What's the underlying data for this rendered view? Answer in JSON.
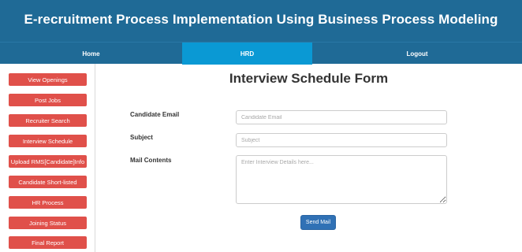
{
  "header": {
    "title": "E-recruitment Process Implementation Using Business Process Modeling"
  },
  "nav": {
    "items": [
      {
        "label": "Home",
        "active": false
      },
      {
        "label": "HRD",
        "active": true
      },
      {
        "label": "Logout",
        "active": false
      }
    ]
  },
  "sidebar": {
    "items": [
      {
        "label": "View Openings"
      },
      {
        "label": "Post Jobs"
      },
      {
        "label": "Recruiter Search"
      },
      {
        "label": "Interview Schedule"
      },
      {
        "label": "Upload RMS[Candidate]Info"
      },
      {
        "label": "Candidate Short-listed"
      },
      {
        "label": "HR Process"
      },
      {
        "label": "Joining Status"
      },
      {
        "label": "Final Report"
      }
    ]
  },
  "form": {
    "title": "Interview Schedule Form",
    "email": {
      "label": "Candidate Email",
      "placeholder": "Candidate Email",
      "value": ""
    },
    "subject": {
      "label": "Subject",
      "placeholder": "Subject",
      "value": ""
    },
    "mail": {
      "label": "Mail Contents",
      "placeholder": "Enter Interview Details here...",
      "value": ""
    },
    "submit_label": "Send Mail"
  },
  "colors": {
    "header_bg": "#1f6a96",
    "nav_active": "#0a99d4",
    "sidebar_button": "#e0504a",
    "submit_button": "#3071b5"
  }
}
